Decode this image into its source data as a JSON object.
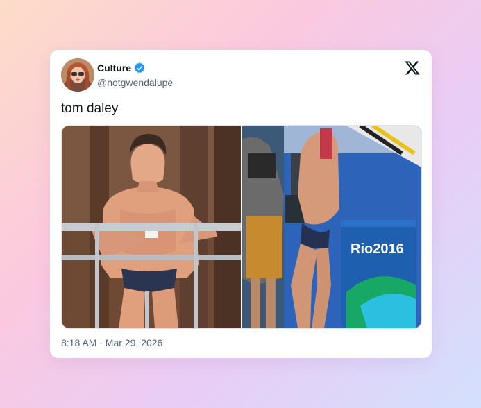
{
  "author": {
    "display_name": "Culture",
    "handle": "@notgwendalupe",
    "verified": true,
    "verified_color": "#1d9bf0"
  },
  "tweet": {
    "text": "tom daley",
    "timestamp": "8:18 AM · Mar 29, 2026"
  },
  "media": {
    "photos": [
      {
        "description_icon": "photo-diver-poolside"
      },
      {
        "description_icon": "photo-diver-rio",
        "sign_text": "Rio2016"
      }
    ]
  },
  "icons": {
    "platform": "x-logo-icon",
    "badge": "verified-badge-icon"
  },
  "colors": {
    "text_primary": "#0f1419",
    "text_secondary": "#536471",
    "background_card": "#ffffff"
  }
}
